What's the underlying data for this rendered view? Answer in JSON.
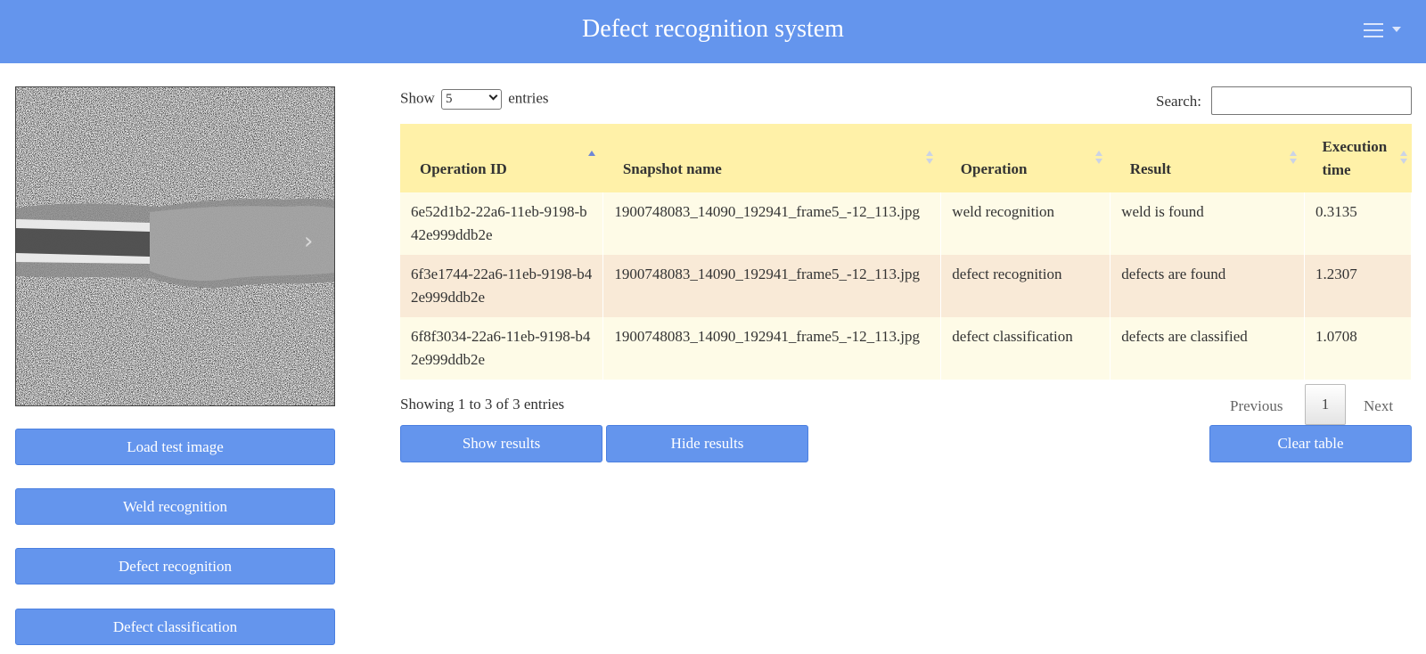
{
  "navbar": {
    "title": "Defect recognition system",
    "menu_icon": "hamburger-icon",
    "color": "#6495ed"
  },
  "image_panel": {
    "next_icon": "chevron-right-icon",
    "next_glyph": "›"
  },
  "sidebar": {
    "load_label": "Load test image",
    "weld_label": "Weld recognition",
    "defect_label": "Defect recognition",
    "classify_label": "Defect classification"
  },
  "table_controls": {
    "show_label": "Show",
    "entries_value": "5",
    "entries_label": "entries",
    "search_label": "Search:",
    "search_value": ""
  },
  "table": {
    "columns": [
      "Operation ID",
      "Snapshot name",
      "Operation",
      "Result",
      "Execution time"
    ],
    "rows": [
      {
        "id": "6e52d1b2-22a6-11eb-9198-b42e999ddb2e",
        "snapshot": "1900748083_14090_192941_frame5_-12_113.jpg",
        "operation": "weld recognition",
        "result": "weld is found",
        "time": "0.3135"
      },
      {
        "id": "6f3e1744-22a6-11eb-9198-b42e999ddb2e",
        "snapshot": "1900748083_14090_192941_frame5_-12_113.jpg",
        "operation": "defect recognition",
        "result": "defects are found",
        "time": "1.2307"
      },
      {
        "id": "6f8f3034-22a6-11eb-9198-b42e999ddb2e",
        "snapshot": "1900748083_14090_192941_frame5_-12_113.jpg",
        "operation": "defect classification",
        "result": "defects are classified",
        "time": "1.0708"
      }
    ],
    "header_color": "#fff1a8",
    "odd_row_color": "#fefbe7",
    "even_row_color": "#f9ead7"
  },
  "footer": {
    "info": "Showing 1 to 3 of 3 entries",
    "previous_label": "Previous",
    "page": "1",
    "next_label": "Next"
  },
  "actions": {
    "show_label": "Show results",
    "hide_label": "Hide results",
    "clear_label": "Clear table"
  }
}
